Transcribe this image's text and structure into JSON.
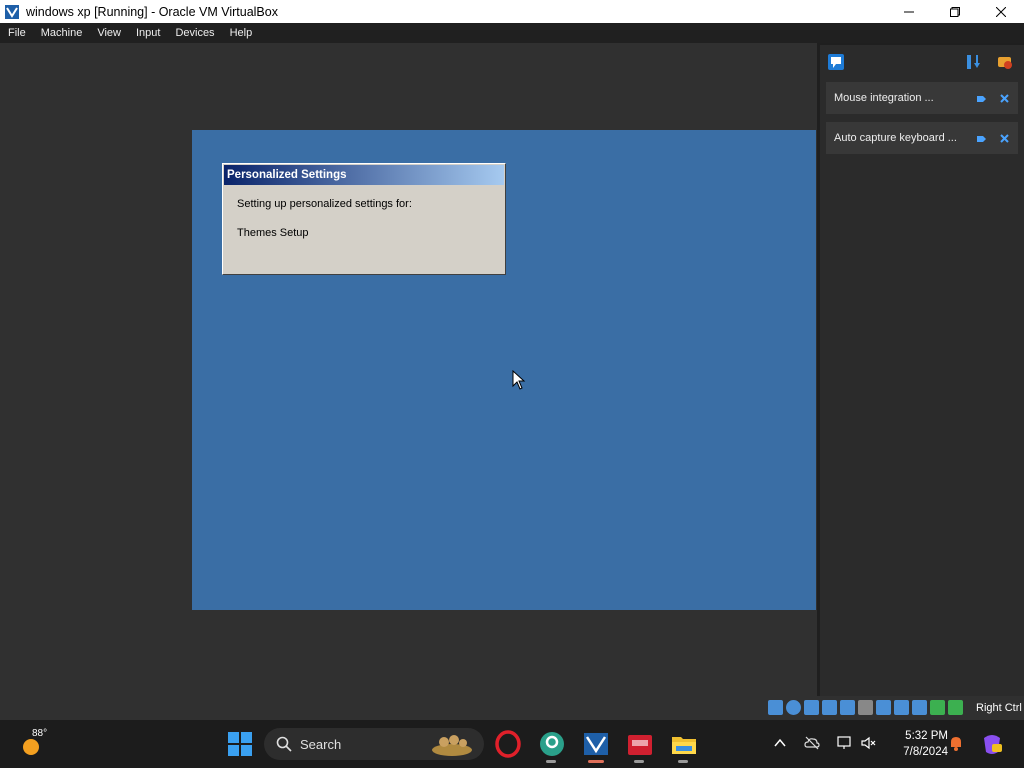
{
  "window": {
    "title": "windows xp [Running] - Oracle VM VirtualBox"
  },
  "menu": {
    "items": [
      "File",
      "Machine",
      "View",
      "Input",
      "Devices",
      "Help"
    ]
  },
  "guest": {
    "dialog_title": "Personalized Settings",
    "line1": "Setting up personalized settings for:",
    "line2": "Themes Setup",
    "background_color": "#3a6ea5"
  },
  "notifications": [
    {
      "text": "Mouse integration ..."
    },
    {
      "text": "Auto capture keyboard ..."
    }
  ],
  "status_bar": {
    "host_key": "Right Ctrl"
  },
  "taskbar": {
    "weather_temp": "88°",
    "search_label": "Search",
    "time": "5:32 PM",
    "date": "7/8/2024"
  },
  "icons": {
    "app": "virtualbox-icon",
    "minimize": "minimize-icon",
    "maximize": "maximize-icon",
    "close": "close-icon"
  }
}
